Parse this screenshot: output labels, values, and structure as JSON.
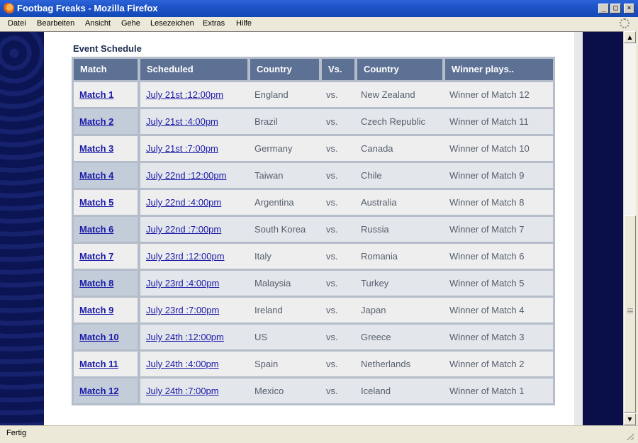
{
  "window": {
    "title": "Footbag Freaks - Mozilla Firefox",
    "min": "_",
    "max": "□",
    "close": "×"
  },
  "menu": [
    "Datei",
    "Bearbeiten",
    "Ansicht",
    "Gehe",
    "Lesezeichen",
    "Extras",
    "Hilfe"
  ],
  "content": {
    "heading": "Event Schedule",
    "columns": [
      "Match",
      "Scheduled",
      "Country",
      "Vs.",
      "Country",
      "Winner plays.."
    ],
    "rows": [
      {
        "match": "Match 1",
        "scheduled": "July 21st :12:00pm",
        "country1": "England",
        "vs": "vs.",
        "country2": "New Zealand",
        "winner": "Winner of Match 12"
      },
      {
        "match": "Match 2",
        "scheduled": "July 21st :4:00pm",
        "country1": "Brazil",
        "vs": "vs.",
        "country2": "Czech Republic",
        "winner": "Winner of Match 11"
      },
      {
        "match": "Match 3",
        "scheduled": "July 21st :7:00pm",
        "country1": "Germany",
        "vs": "vs.",
        "country2": "Canada",
        "winner": "Winner of Match 10"
      },
      {
        "match": "Match 4",
        "scheduled": "July 22nd :12:00pm",
        "country1": "Taiwan",
        "vs": "vs.",
        "country2": "Chile",
        "winner": "Winner of Match 9"
      },
      {
        "match": "Match 5",
        "scheduled": "July 22nd :4:00pm",
        "country1": "Argentina",
        "vs": "vs.",
        "country2": "Australia",
        "winner": "Winner of Match 8"
      },
      {
        "match": "Match 6",
        "scheduled": "July 22nd :7:00pm",
        "country1": "South Korea",
        "vs": "vs.",
        "country2": "Russia",
        "winner": "Winner of Match 7"
      },
      {
        "match": "Match 7",
        "scheduled": "July 23rd :12:00pm",
        "country1": "Italy",
        "vs": "vs.",
        "country2": "Romania",
        "winner": "Winner of Match 6"
      },
      {
        "match": "Match 8",
        "scheduled": "July 23rd :4:00pm",
        "country1": "Malaysia",
        "vs": "vs.",
        "country2": "Turkey",
        "winner": "Winner of Match 5"
      },
      {
        "match": "Match 9",
        "scheduled": "July 23rd :7:00pm",
        "country1": "Ireland",
        "vs": "vs.",
        "country2": "Japan",
        "winner": "Winner of Match 4"
      },
      {
        "match": "Match 10",
        "scheduled": "July 24th :12:00pm",
        "country1": "US",
        "vs": "vs.",
        "country2": "Greece",
        "winner": "Winner of Match 3"
      },
      {
        "match": "Match 11",
        "scheduled": "July 24th :4:00pm",
        "country1": "Spain",
        "vs": "vs.",
        "country2": "Netherlands",
        "winner": "Winner of Match 2"
      },
      {
        "match": "Match 12",
        "scheduled": "July 24th :7:00pm",
        "country1": "Mexico",
        "vs": "vs.",
        "country2": "Iceland",
        "winner": "Winner of Match 1"
      }
    ]
  },
  "status": {
    "text": "Fertig"
  },
  "colors": {
    "header_bg": "#5d7194",
    "link": "#1a1aa8",
    "page_bg": "#0c1554",
    "titlebar": "#1f55c8"
  },
  "icons": {
    "app": "firefox-icon",
    "throbber": "throbber-icon",
    "scroll_up": "arrow-up-icon",
    "scroll_down": "arrow-down-icon"
  }
}
